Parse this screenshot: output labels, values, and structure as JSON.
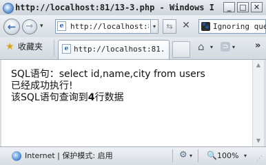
{
  "window": {
    "title": "http://localhost:81/13-3.php - Windows I...",
    "minimize_glyph": "_",
    "maximize_glyph": "□",
    "close_glyph": "✕"
  },
  "navigation": {
    "back_glyph": "←",
    "forward_glyph": "→",
    "history_dropdown_glyph": "▾",
    "address_value": "http://localhost:8",
    "address_dropdown_glyph": "▾",
    "compat_glyph": "⇆",
    "refresh_glyph": "↻",
    "stop_glyph": "✕",
    "search_value": "Ignoring que",
    "search_engine_glyph": "🐾"
  },
  "favorites_bar": {
    "favorites_label": "收藏夹",
    "star_glyph": "★",
    "tab_label": "http://localhost:81...",
    "home_glyph": "⌂",
    "feeds_glyph": "⊃",
    "dropdown_glyph": "▾",
    "more_glyph": "»"
  },
  "content": {
    "line1": "SQL语句：select id,name,city from users",
    "line2": "已经成功执行!",
    "line3_prefix": "该SQL语句查询到",
    "line3_count": "4",
    "line3_suffix": "行数据"
  },
  "scrollbar": {
    "up_glyph": "▲",
    "down_glyph": "▼"
  },
  "status_bar": {
    "status_text": "Internet | 保护模式: 启用",
    "zoom": "100%",
    "dropdown_glyph": "▾",
    "addons_glyph": "⚙",
    "zoom_glyph": "🔍"
  },
  "colors": {
    "chrome_background": "#d9dde3",
    "content_background": "#ffffff",
    "text": "#111111"
  }
}
